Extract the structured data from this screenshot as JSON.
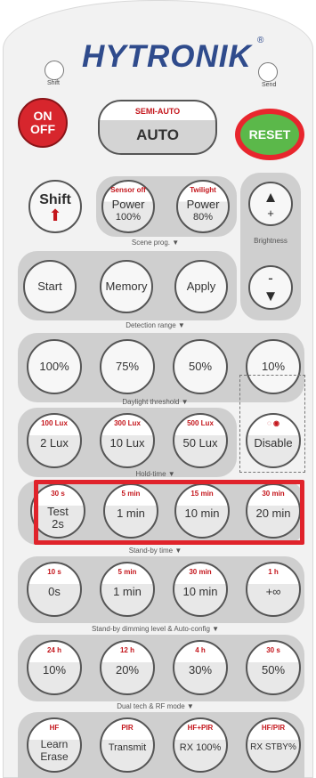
{
  "header": {
    "brand": "HYTRONIK",
    "registered": "®",
    "shift_led_label": "Shift",
    "send_led_label": "Send"
  },
  "top_row": {
    "on_off": {
      "line1": "ON",
      "line2": "OFF"
    },
    "mode": {
      "top": "SEMI-AUTO",
      "main": "AUTO"
    },
    "reset": "RESET"
  },
  "shift": {
    "label": "Shift",
    "arrow": "⬆"
  },
  "power_buttons": [
    {
      "top": "Sensor off",
      "line1": "Power",
      "line2": "100%"
    },
    {
      "top": "Twilight",
      "line1": "Power",
      "line2": "80%"
    }
  ],
  "brightness": {
    "up": "▲",
    "up_sign": "+",
    "label": "Brightness",
    "down_sign": "-",
    "down": "▼"
  },
  "scene_prog": {
    "label": "Scene prog. ▼",
    "buttons": [
      "Start",
      "Memory",
      "Apply"
    ]
  },
  "detection_range": {
    "label": "Detection range ▼",
    "buttons": [
      "100%",
      "75%",
      "50%",
      "10%"
    ]
  },
  "daylight_threshold": {
    "label": "Daylight threshold ▼",
    "buttons": [
      {
        "top": "100 Lux",
        "main": "2 Lux"
      },
      {
        "top": "300 Lux",
        "main": "10 Lux"
      },
      {
        "top": "500 Lux",
        "main": "50 Lux"
      },
      {
        "top": "◌ ◉",
        "main": "Disable"
      }
    ]
  },
  "hold_time": {
    "label": "Hold-time ▼",
    "buttons": [
      {
        "top": "30 s",
        "main": "Test",
        "sub": "2s"
      },
      {
        "top": "5 min",
        "main": "1 min"
      },
      {
        "top": "15 min",
        "main": "10 min"
      },
      {
        "top": "30 min",
        "main": "20 min"
      }
    ]
  },
  "standby_time": {
    "label": "Stand-by time ▼",
    "buttons": [
      {
        "top": "10 s",
        "main": "0s"
      },
      {
        "top": "5 min",
        "main": "1 min"
      },
      {
        "top": "30 min",
        "main": "10 min"
      },
      {
        "top": "1 h",
        "main": "+∞"
      }
    ]
  },
  "dimming": {
    "label": "Stand-by dimming level & Auto-config ▼",
    "buttons": [
      {
        "top": "24 h",
        "main": "10%"
      },
      {
        "top": "12 h",
        "main": "20%"
      },
      {
        "top": "4 h",
        "main": "30%"
      },
      {
        "top": "30 s",
        "main": "50%"
      }
    ]
  },
  "dual_tech": {
    "label": "Dual tech & RF mode ▼",
    "buttons": [
      {
        "top": "HF",
        "main": "Learn",
        "sub": "Erase"
      },
      {
        "top": "PIR",
        "main": "Transmit"
      },
      {
        "top": "HF+PIR",
        "main": "RX 100%"
      },
      {
        "top": "HF/PIR",
        "main": "RX STBY%"
      }
    ]
  }
}
